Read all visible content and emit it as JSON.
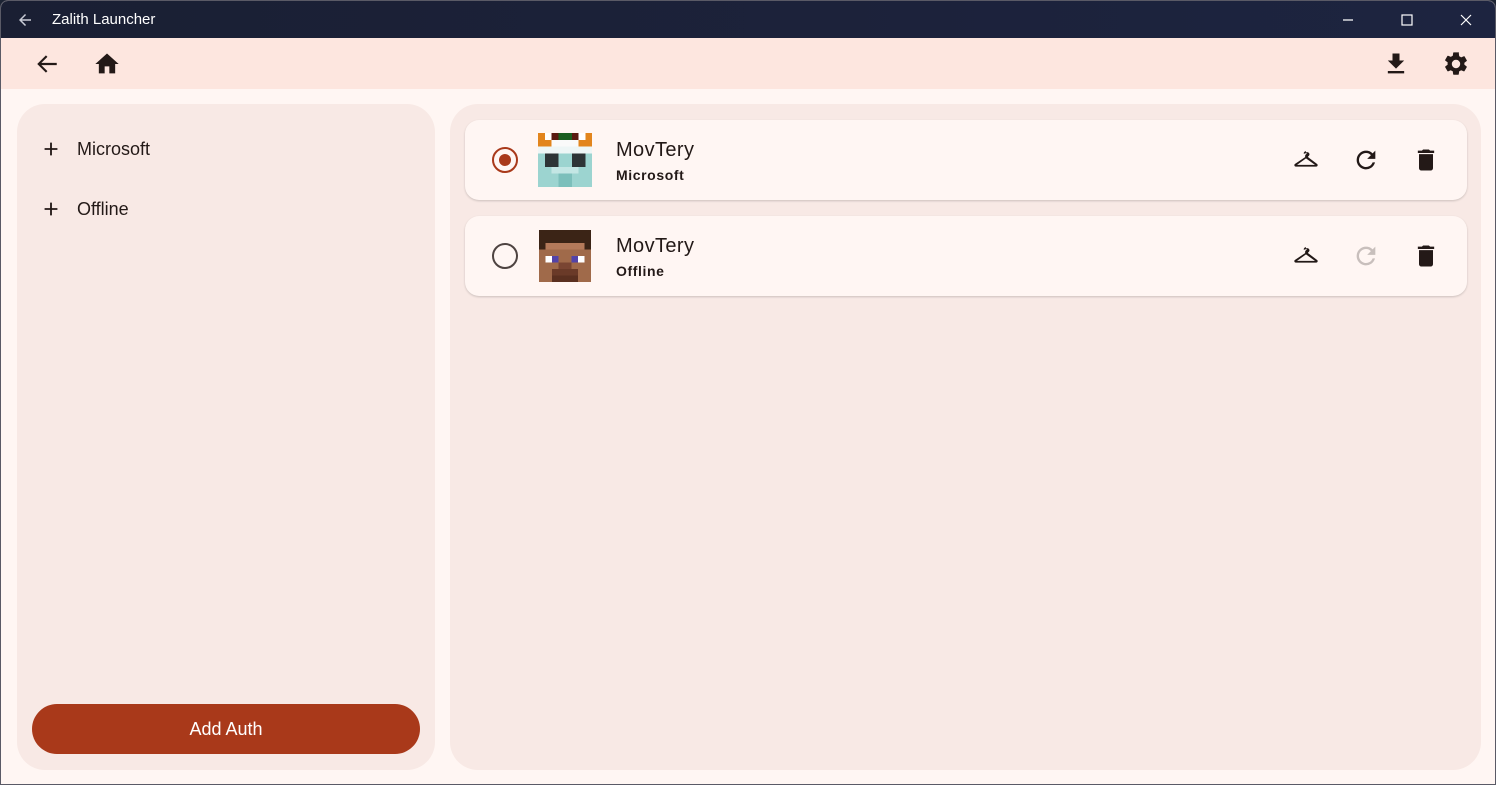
{
  "window": {
    "title": "Zalith Launcher"
  },
  "appbar": {
    "icons": [
      "back-arrow-icon",
      "home-icon",
      "download-icon",
      "settings-icon"
    ]
  },
  "sidebar": {
    "items": [
      {
        "label": "Microsoft",
        "icon": "plus-icon"
      },
      {
        "label": "Offline",
        "icon": "plus-icon"
      }
    ],
    "add_auth_label": "Add Auth"
  },
  "accounts": [
    {
      "name": "MovTery",
      "type": "Microsoft",
      "selected": true,
      "refresh_enabled": true
    },
    {
      "name": "MovTery",
      "type": "Offline",
      "selected": false,
      "refresh_enabled": false
    }
  ],
  "colors": {
    "accent": "#a9391a",
    "appbar": "#fde6df",
    "panel": "#f8e9e5",
    "titlebar": "#1a1f33"
  }
}
